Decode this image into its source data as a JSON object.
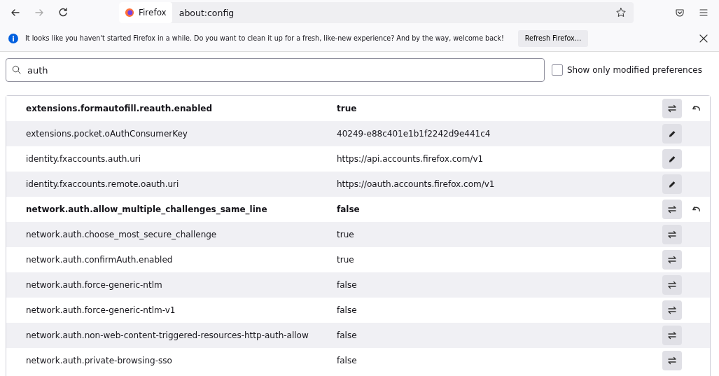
{
  "toolbar": {
    "site_label": "Firefox",
    "address": "about:config"
  },
  "notification": {
    "message": "It looks like you haven't started Firefox in a while. Do you want to clean it up for a fresh, like-new experience? And by the way, welcome back!",
    "button": "Refresh Firefox…"
  },
  "search": {
    "value": "auth"
  },
  "modified_only": {
    "label": "Show only modified preferences",
    "checked": false
  },
  "preferences": [
    {
      "name": "extensions.formautofill.reauth.enabled",
      "value": "true",
      "kind": "boolean",
      "modified": true
    },
    {
      "name": "extensions.pocket.oAuthConsumerKey",
      "value": "40249-e88c401e1b1f2242d9e441c4",
      "kind": "string",
      "modified": false
    },
    {
      "name": "identity.fxaccounts.auth.uri",
      "value": "https://api.accounts.firefox.com/v1",
      "kind": "string",
      "modified": false
    },
    {
      "name": "identity.fxaccounts.remote.oauth.uri",
      "value": "https://oauth.accounts.firefox.com/v1",
      "kind": "string",
      "modified": false
    },
    {
      "name": "network.auth.allow_multiple_challenges_same_line",
      "value": "false",
      "kind": "boolean",
      "modified": true
    },
    {
      "name": "network.auth.choose_most_secure_challenge",
      "value": "true",
      "kind": "boolean",
      "modified": false
    },
    {
      "name": "network.auth.confirmAuth.enabled",
      "value": "true",
      "kind": "boolean",
      "modified": false
    },
    {
      "name": "network.auth.force-generic-ntlm",
      "value": "false",
      "kind": "boolean",
      "modified": false
    },
    {
      "name": "network.auth.force-generic-ntlm-v1",
      "value": "false",
      "kind": "boolean",
      "modified": false
    },
    {
      "name": "network.auth.non-web-content-triggered-resources-http-auth-allow",
      "value": "false",
      "kind": "boolean",
      "modified": false
    },
    {
      "name": "network.auth.private-browsing-sso",
      "value": "false",
      "kind": "boolean",
      "modified": false
    }
  ]
}
